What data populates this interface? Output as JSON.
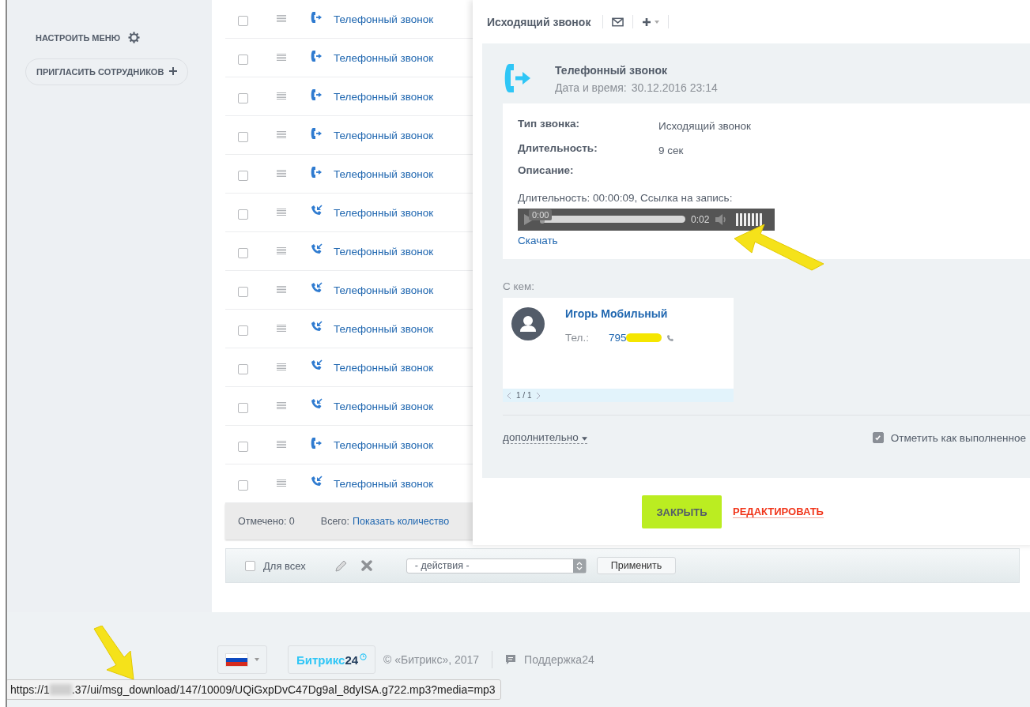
{
  "sidebar": {
    "menu_settings": "НАСТРОИТЬ МЕНЮ",
    "invite_button": "ПРИГЛАСИТЬ СОТРУДНИКОВ"
  },
  "list": {
    "rows": [
      {
        "title": "Телефонный звонок",
        "kind": "outgoing",
        "checked": false
      },
      {
        "title": "Телефонный звонок",
        "kind": "outgoing",
        "checked": false
      },
      {
        "title": "Телефонный звонок",
        "kind": "outgoing",
        "checked": false
      },
      {
        "title": "Телефонный звонок",
        "kind": "outgoing",
        "checked": false
      },
      {
        "title": "Телефонный звонок",
        "kind": "outgoing",
        "checked": false
      },
      {
        "title": "Телефонный звонок",
        "kind": "incoming",
        "checked": false
      },
      {
        "title": "Телефонный звонок",
        "kind": "incoming",
        "checked": false
      },
      {
        "title": "Телефонный звонок",
        "kind": "incoming",
        "checked": false
      },
      {
        "title": "Телефонный звонок",
        "kind": "incoming",
        "checked": false
      },
      {
        "title": "Телефонный звонок",
        "kind": "incoming",
        "checked": false
      },
      {
        "title": "Телефонный звонок",
        "kind": "incoming",
        "checked": false
      },
      {
        "title": "Телефонный звонок",
        "kind": "outgoing",
        "checked": false
      },
      {
        "title": "Телефонный звонок",
        "kind": "incoming",
        "checked": false
      }
    ],
    "footer": {
      "marked": "Отмечено: 0",
      "total_label": "Всего:",
      "total_link": "Показать количество"
    }
  },
  "action_bar": {
    "for_all": {
      "label": "Для всех",
      "checked": false
    },
    "actions_select": "- действия -",
    "apply": "Применить"
  },
  "panel": {
    "title": "Исходящий звонок",
    "activity": {
      "title": "Телефонный звонок",
      "date_label": "Дата и время:",
      "date": "30.12.2016 23:14"
    },
    "fields": [
      {
        "label": "Тип звонка:",
        "value": "Исходящий звонок"
      },
      {
        "label": "Длительность:",
        "value": "9 сек"
      }
    ],
    "description_label": "Описание:",
    "description": "Длительность: 00:00:09, Ссылка на запись:",
    "player": {
      "tooltip": "0:00",
      "time": "0:02",
      "progress": {
        "level": 0
      },
      "volume": {
        "level": 1
      }
    },
    "download": "Скачать",
    "with_label": "С кем:",
    "contact": {
      "name": "Игорь Мобильный",
      "phone_label": "Тел.:",
      "phone": "795",
      "pager": "1 / 1"
    },
    "more": "дополнительно",
    "mark_done": {
      "label": "Отметить как выполненное",
      "checked": true
    },
    "close_button": "ЗАКРЫТЬ",
    "edit_button": "РЕДАКТИРОВАТЬ"
  },
  "footer": {
    "logo": "Битрикс",
    "logo_number": "24",
    "copyright": "© «Битрикс», 2017",
    "support": "Поддержка24"
  },
  "status_url": {
    "start": "https://1",
    "end": ".37/ui/msg_download/147/10009/UQiGxpDvC47Dg9al_8dyISA.g722.mp3?media=mp3"
  }
}
